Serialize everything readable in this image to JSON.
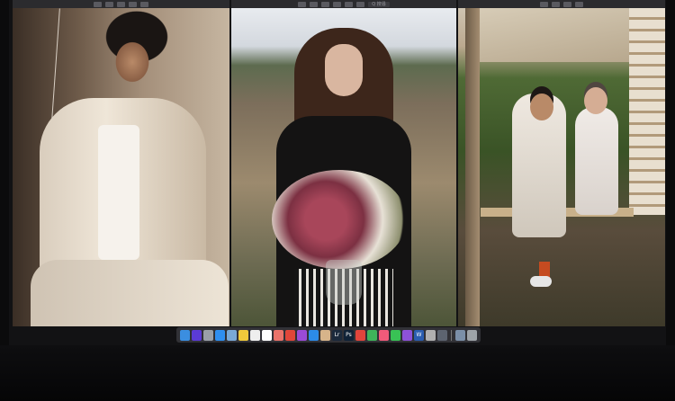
{
  "windows": [
    {
      "id": "w1",
      "toolbar_icons": [
        "back-icon",
        "zoom-out-icon",
        "zoom-in-icon",
        "share-icon",
        "rotate-icon"
      ]
    },
    {
      "id": "w2",
      "toolbar_icons": [
        "back-icon",
        "zoom-out-icon",
        "zoom-in-icon",
        "share-icon",
        "edit-icon",
        "info-icon"
      ],
      "search_label": "Q 搜尋"
    },
    {
      "id": "w3",
      "toolbar_icons": [
        "back-icon",
        "zoom-out-icon",
        "zoom-in-icon",
        "share-icon"
      ]
    }
  ],
  "dock": {
    "apps": [
      {
        "name": "finder",
        "label": "",
        "color": "#3b8ee0"
      },
      {
        "name": "siri",
        "label": "",
        "color": "#5b3bd6"
      },
      {
        "name": "launchpad",
        "label": "",
        "color": "#9aa0a8"
      },
      {
        "name": "safari",
        "label": "",
        "color": "#2f8ff0"
      },
      {
        "name": "preview",
        "label": "",
        "color": "#7aa9d6"
      },
      {
        "name": "notes",
        "label": "",
        "color": "#f0c93b"
      },
      {
        "name": "reminders",
        "label": "",
        "color": "#eeeeee"
      },
      {
        "name": "calendar",
        "label": "",
        "color": "#ffffff"
      },
      {
        "name": "photos",
        "label": "",
        "color": "#e9736a"
      },
      {
        "name": "chrome",
        "label": "",
        "color": "#e0463a"
      },
      {
        "name": "podcasts",
        "label": "",
        "color": "#9a4bd6"
      },
      {
        "name": "app-store",
        "label": "",
        "color": "#2c8be8"
      },
      {
        "name": "contacts",
        "label": "",
        "color": "#d7b48a"
      },
      {
        "name": "lightroom",
        "label": "Lr",
        "color": "#1b2a3c"
      },
      {
        "name": "photoshop",
        "label": "Ps",
        "color": "#0f2237"
      },
      {
        "name": "app-red",
        "label": "",
        "color": "#e0453c"
      },
      {
        "name": "app-green",
        "label": "",
        "color": "#3fb35a"
      },
      {
        "name": "app-pink",
        "label": "",
        "color": "#f05a7a"
      },
      {
        "name": "wechat",
        "label": "",
        "color": "#39c255"
      },
      {
        "name": "app-purple",
        "label": "",
        "color": "#8d52d8"
      },
      {
        "name": "word",
        "label": "W",
        "color": "#2a5db0"
      },
      {
        "name": "app-grey",
        "label": "",
        "color": "#b0b0b0"
      },
      {
        "name": "app-dark",
        "label": "",
        "color": "#5d6470"
      },
      {
        "name": "finder-window",
        "label": "",
        "color": "#7b8fa8"
      },
      {
        "name": "trash",
        "label": "",
        "color": "#9ea3a8"
      }
    ]
  }
}
